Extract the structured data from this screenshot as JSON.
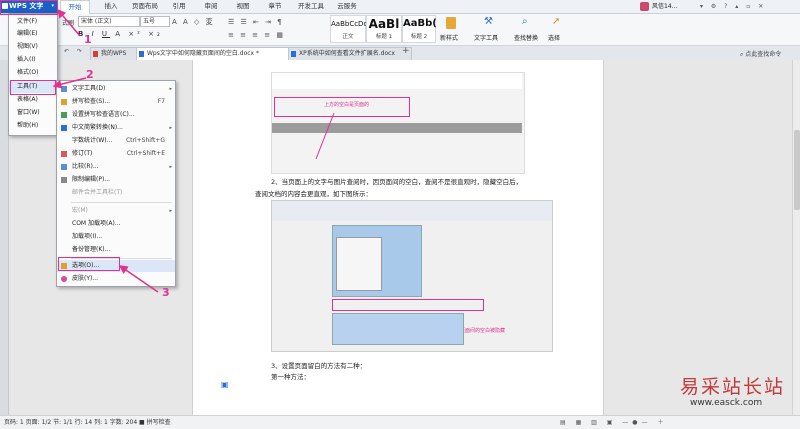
{
  "app": {
    "name": "WPS 文字"
  },
  "ribbon_tabs": [
    "开始",
    "插入",
    "页面布局",
    "引用",
    "审阅",
    "视图",
    "章节",
    "开发工具",
    "云服务"
  ],
  "ribbon": {
    "font_name": "宋体 (正文)",
    "font_size": "五号",
    "left_label": "式刷",
    "styles": [
      {
        "sample": "AaBbCcDd",
        "label": "正文"
      },
      {
        "sample": "AaBl",
        "label": "标题 1"
      },
      {
        "sample": "AaBb(",
        "label": "标题 2"
      }
    ],
    "new_style": "新样式",
    "text_tools": "文字工具",
    "find_replace": "查找替换",
    "select": "选择"
  },
  "user": {
    "name": "风信14..."
  },
  "doc_tabs": [
    {
      "label": "我的WPS"
    },
    {
      "label": "Wps文字中如何隐藏页面间的空白.docx *"
    },
    {
      "label": "XP系统中如何查看文件扩展名.docx"
    }
  ],
  "top_right_hint": "点此查找命令",
  "main_menu": {
    "items": [
      "文件(F)",
      "编辑(E)",
      "视图(V)",
      "插入(I)",
      "格式(O)",
      "工具(T)",
      "表格(A)",
      "窗口(W)",
      "帮助(H)"
    ],
    "highlighted": "工具(T)"
  },
  "tools_menu": {
    "items": [
      {
        "label": "文字工具(D)",
        "arrow": "▸"
      },
      {
        "label": "拼写检查(S)...",
        "shortcut": "F7"
      },
      {
        "label": "设置拼写检查语言(C)..."
      },
      {
        "label": "中文简繁转换(N)...",
        "arrow": "▸"
      },
      {
        "label": "字数统计(W)...",
        "shortcut": "Ctrl+Shift+G"
      },
      {
        "label": "修订(T)",
        "shortcut": "Ctrl+Shift+E"
      },
      {
        "label": "比较(R)...",
        "arrow": "▸"
      },
      {
        "label": "限制编辑(P)..."
      },
      {
        "label": "邮件合并工具栏(T)",
        "disabled": true
      },
      {
        "label": "宏(M)",
        "arrow": "▸",
        "disabled": true
      },
      {
        "label": "COM 加载项(A)..."
      },
      {
        "label": "加载项(I)..."
      },
      {
        "label": "备份管理(K)..."
      },
      {
        "label": "选项(O)..."
      },
      {
        "label": "皮肤(Y)..."
      }
    ],
    "highlighted": "选项(O)..."
  },
  "annotations": {
    "n1": "1",
    "n2": "2",
    "n3": "3",
    "color": "#e0338f"
  },
  "document": {
    "caption1": "上方的空白是页面的",
    "para2_line1": "2、当页面上的文字与图片查阅时，因页面间的空白，查阅不是很直观时，隐藏空白后，",
    "para2_line2": "查阅文档的内容会更直观，如下图所示：",
    "caption2": "页面间的空白被隐藏",
    "para3_line1": "3、设置页面留白的方法有二种：",
    "para3_line2": "第一种方法："
  },
  "status_bar": {
    "text": "页码: 1  页面: 1/2  节: 1/1  行: 14  列: 1  字数: 204  ■ 拼写检查"
  },
  "watermark": {
    "cn": "易采站长站",
    "url": "www.easck.com"
  }
}
